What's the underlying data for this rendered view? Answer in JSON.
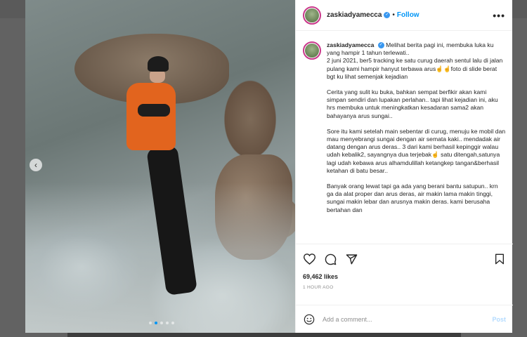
{
  "post": {
    "username": "zaskiadyamecca",
    "follow_label": "Follow",
    "more_label": "•••",
    "carousel": {
      "total": 5,
      "active": 2,
      "prev_label": "‹"
    },
    "caption": {
      "username": "zaskiadyamecca",
      "paragraphs": [
        "Melihat berita pagi ini, membuka luka ku yang hampir 1 tahun terlewati..",
        "2 juni 2021, ber5 tracking ke satu curug daerah sentul lalu di jalan pulang kami hampir hanyut terbawa arus☝️☝️foto di slide berat bgt ku lihat semenjak kejadian",
        "Cerita yang sulit ku buka, bahkan sempat berfikir akan kami simpan sendiri dan lupakan perlahan.. tapi lihat kejadian ini, aku hrs membuka untuk meningkatkan kesadaran sama2 akan bahayanya arus sungai..",
        "Sore itu kami setelah main sebentar di curug, menuju ke mobil dan mau menyebrangi sungai dengan air semata kaki.. mendadak air datang dengan arus deras.. 3 dari kami berhasil kepinggir walau udah kebalik2, sayangnya dua terjebak☝️ satu ditengah,satunya lagi udah kebawa arus alhamdulillah ketangkep tangan&berhasil ketahan di batu besar..",
        "Banyak orang lewat tapi ga ada yang berani bantu satupun.. krn ga da alat proper dan arus deras, air makin lama makin tinggi, sungai makin lebar dan arusnya makin deras. kami berusaha bertahan dan"
      ]
    },
    "likes": "69,462 likes",
    "time_ago": "1 HOUR AGO",
    "comment": {
      "placeholder": "Add a comment...",
      "post_label": "Post"
    }
  },
  "icons": [
    "heart-icon",
    "comment-icon",
    "share-icon",
    "bookmark-icon",
    "emoji-icon",
    "verified-icon",
    "more-icon",
    "chevron-left-icon"
  ],
  "colors": {
    "accent": "#0095f6",
    "text": "#262626",
    "muted": "#8e8e8e",
    "verified": "#3897f0",
    "jacket": "#e2641e"
  }
}
